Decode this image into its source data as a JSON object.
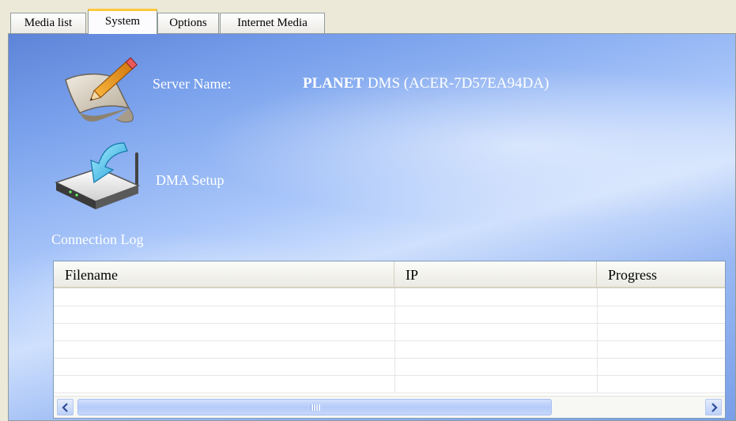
{
  "tabs": [
    {
      "label": "Media list"
    },
    {
      "label": "System"
    },
    {
      "label": "Options"
    },
    {
      "label": "Internet Media"
    }
  ],
  "active_tab": "System",
  "server": {
    "label": "Server Name:",
    "value_bold": "PLANET",
    "value_rest": " DMS (ACER-7D57EA94DA)",
    "icon": "pencil-paper-icon"
  },
  "dma": {
    "label": "DMA Setup",
    "icon": "router-download-icon"
  },
  "connection_log": {
    "label": "Connection Log",
    "columns": [
      "Filename",
      "IP",
      "Progress"
    ],
    "rows": []
  },
  "colors": {
    "panel_blue": "#7aa2ec",
    "tab_highlight": "#ffc83c",
    "scrollbar": "#bcd0f8"
  }
}
